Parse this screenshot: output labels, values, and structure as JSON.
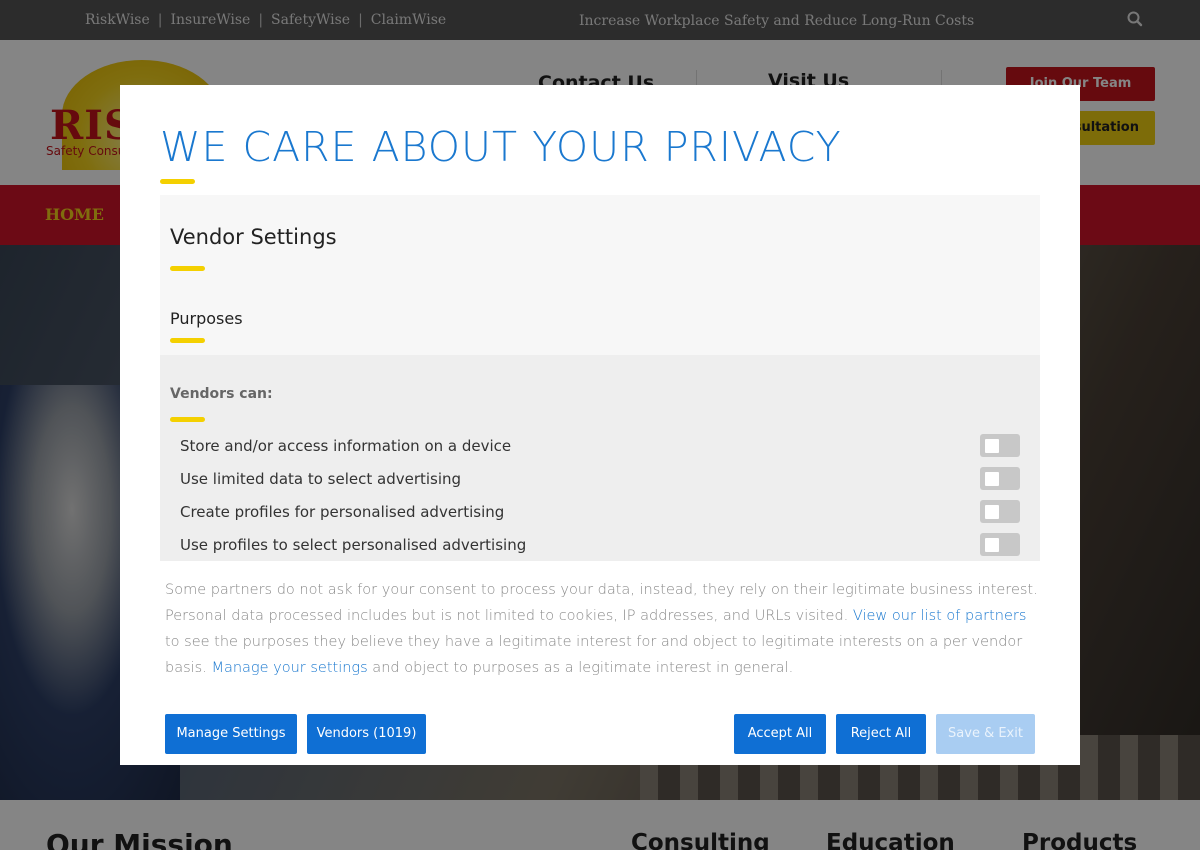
{
  "topbar": {
    "links": [
      "RiskWise",
      "InsureWise",
      "SafetyWise",
      "ClaimWise"
    ],
    "separator": "|",
    "tagline": "Increase Workplace Safety and Reduce Long-Run Costs"
  },
  "header": {
    "logo_word": "RISK",
    "logo_sub": "Safety Consu",
    "contact": "Contact Us",
    "visit": "Visit Us",
    "join_button": "Join Our Team",
    "consult_button": "sultation"
  },
  "nav": {
    "home": "HOME"
  },
  "mission": {
    "title": "Our Mission",
    "col1": "Consulting",
    "col2": "Education",
    "col3": "Products"
  },
  "modal": {
    "title": "WE CARE ABOUT YOUR PRIVACY",
    "vendor_settings": "Vendor Settings",
    "purposes_heading": "Purposes",
    "vendors_can": "Vendors can:",
    "purposes": [
      {
        "label": "Store and/or access information on a device",
        "enabled": false
      },
      {
        "label": "Use limited data to select advertising",
        "enabled": false
      },
      {
        "label": "Create profiles for personalised advertising",
        "enabled": false
      },
      {
        "label": "Use profiles to select personalised advertising",
        "enabled": false
      }
    ],
    "consent": {
      "part1": "Some partners do not ask for your consent to process your data, instead, they rely on their legitimate business interest. Personal data processed includes but is not limited to cookies, IP addresses, and URLs visited. ",
      "link1": "View our list of partners",
      "part2": " to see the purposes they believe they have a legitimate interest for and object to legitimate interests on a per vendor basis. ",
      "link2": "Manage your settings",
      "part3": " and object to purposes as a legitimate interest in general."
    },
    "buttons": {
      "manage": "Manage Settings",
      "vendors": "Vendors (1019)",
      "accept": "Accept All",
      "reject": "Reject All",
      "save": "Save & Exit"
    }
  },
  "colors": {
    "accent_blue": "#1a78cf",
    "button_blue": "#0f6fd4",
    "underline_yellow": "#f4d000",
    "brand_red": "#c4151c"
  }
}
